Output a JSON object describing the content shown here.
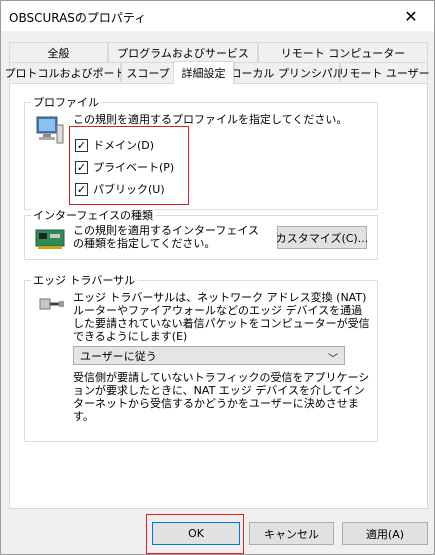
{
  "window": {
    "title": "OBSCURASのプロパティ",
    "close_symbol": "✕"
  },
  "tabs_row1": [
    {
      "label": "全般"
    },
    {
      "label": "プログラムおよびサービス"
    },
    {
      "label": "リモート コンピューター"
    }
  ],
  "tabs_row2": [
    {
      "label": "プロトコルおよびポート"
    },
    {
      "label": "スコープ"
    },
    {
      "label": "詳細設定",
      "active": true
    },
    {
      "label": "ローカル プリンシパル"
    },
    {
      "label": "リモート ユーザー"
    }
  ],
  "profile": {
    "legend": "プロファイル",
    "desc": "この規則を適用するプロファイルを指定してください。",
    "items": [
      {
        "label": "ドメイン(D)",
        "checked": true
      },
      {
        "label": "プライベート(P)",
        "checked": true
      },
      {
        "label": "パブリック(U)",
        "checked": true
      }
    ],
    "check_mark": "✓"
  },
  "interface": {
    "legend": "インターフェイスの種類",
    "desc": "この規則を適用するインターフェイスの種類を指定してください。",
    "customize_label": "カスタマイズ(C)..."
  },
  "edge": {
    "legend": "エッジ トラバーサル",
    "desc": "エッジ トラバーサルは、ネットワーク アドレス変換 (NAT) ルーターやファイアウォールなどのエッジ デバイスを通過した要請されていない着信パケットをコンピューターが受信できるようにします(E)",
    "select_value": "ユーザーに従う",
    "chevron": "﹀",
    "note": "受信側が要請していないトラフィックの受信をアプリケーションが要求したときに、NAT エッジ デバイスを介してインターネットから受信するかどうかをユーザーに決めさせます。"
  },
  "buttons": {
    "ok": "OK",
    "cancel": "キャンセル",
    "apply": "適用(A)"
  },
  "colors": {
    "highlight": "#e02020",
    "accent": "#0078d7"
  }
}
